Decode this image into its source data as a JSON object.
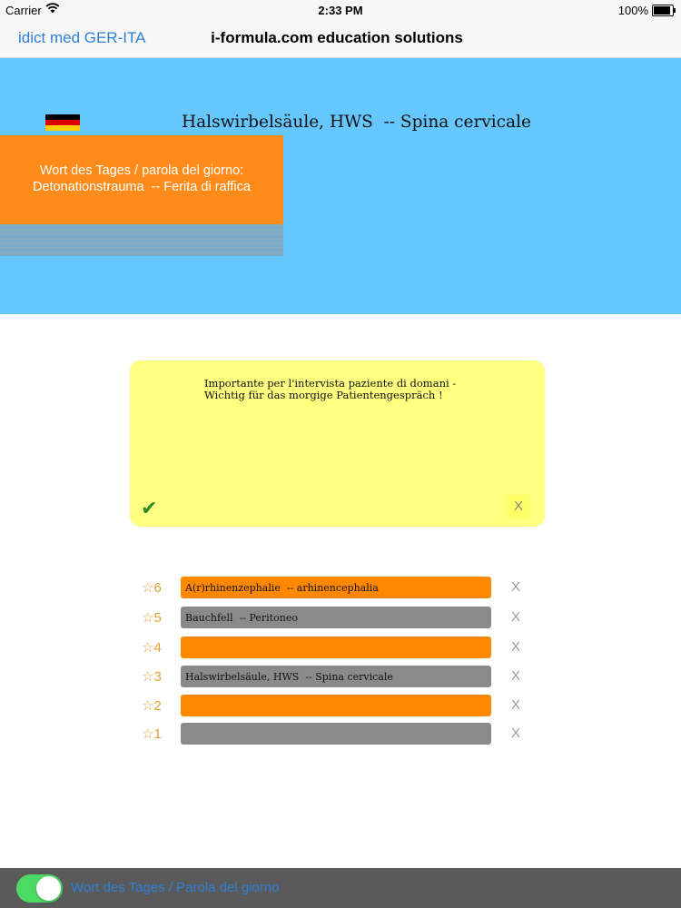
{
  "status_bar": {
    "carrier": "Carrier",
    "time": "2:33 PM",
    "battery_percent": "100%",
    "battery_level": 1.0
  },
  "nav_bar": {
    "back_label": "idict med GER-ITA",
    "title": "i-formula.com education solutions"
  },
  "hero": {
    "flag_colors": [
      "#000000",
      "#dd0000",
      "#ffce00"
    ],
    "term": "Halswirbelsäule, HWS  -- Spina cervicale"
  },
  "word_of_day": {
    "heading": "Wort des Tages / parola del giorno:",
    "term": "Detonationstrauma  -- Ferita di raffica"
  },
  "note": {
    "text": "Importante per l'intervista paziente di domani - Wichtig für das morgige Patientengespräch !",
    "confirm_symbol": "✔",
    "close_symbol": "X"
  },
  "favorites": [
    {
      "rank_label": "☆6",
      "term": "A(r)rhinenzephalie  -- arhinencephalia",
      "color": "orange",
      "remove_label": "X"
    },
    {
      "rank_label": "☆5",
      "term": "Bauchfell  -- Peritoneo",
      "color": "gray",
      "remove_label": "X"
    },
    {
      "rank_label": "☆4",
      "term": "",
      "color": "orange",
      "remove_label": "X"
    },
    {
      "rank_label": "☆3",
      "term": "Halswirbelsäule, HWS  -- Spina cervicale",
      "color": "gray",
      "remove_label": "X"
    },
    {
      "rank_label": "☆2",
      "term": "",
      "color": "orange",
      "remove_label": "X"
    },
    {
      "rank_label": "☆1",
      "term": "",
      "color": "gray",
      "remove_label": "X"
    }
  ],
  "toolbar": {
    "toggle_on": true,
    "label": "Wort des Tages / Parola del giorno"
  },
  "colors": {
    "accent_blue": "#2f7fd6",
    "hero_blue": "#66c7ff",
    "orange": "#ff8800",
    "note_yellow": "#ffff80"
  }
}
